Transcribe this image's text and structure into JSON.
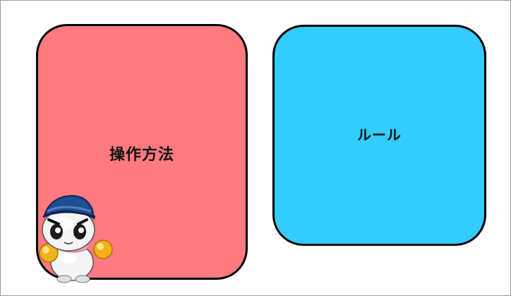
{
  "menu": {
    "controls_label": "操作方法",
    "rules_label": "ルール"
  },
  "colors": {
    "controls_panel": "#ff7a7e",
    "rules_panel": "#33ccff",
    "border": "#000000",
    "background": "#ffffff"
  },
  "mascot": {
    "icon": "snowman-mascot-icon"
  }
}
